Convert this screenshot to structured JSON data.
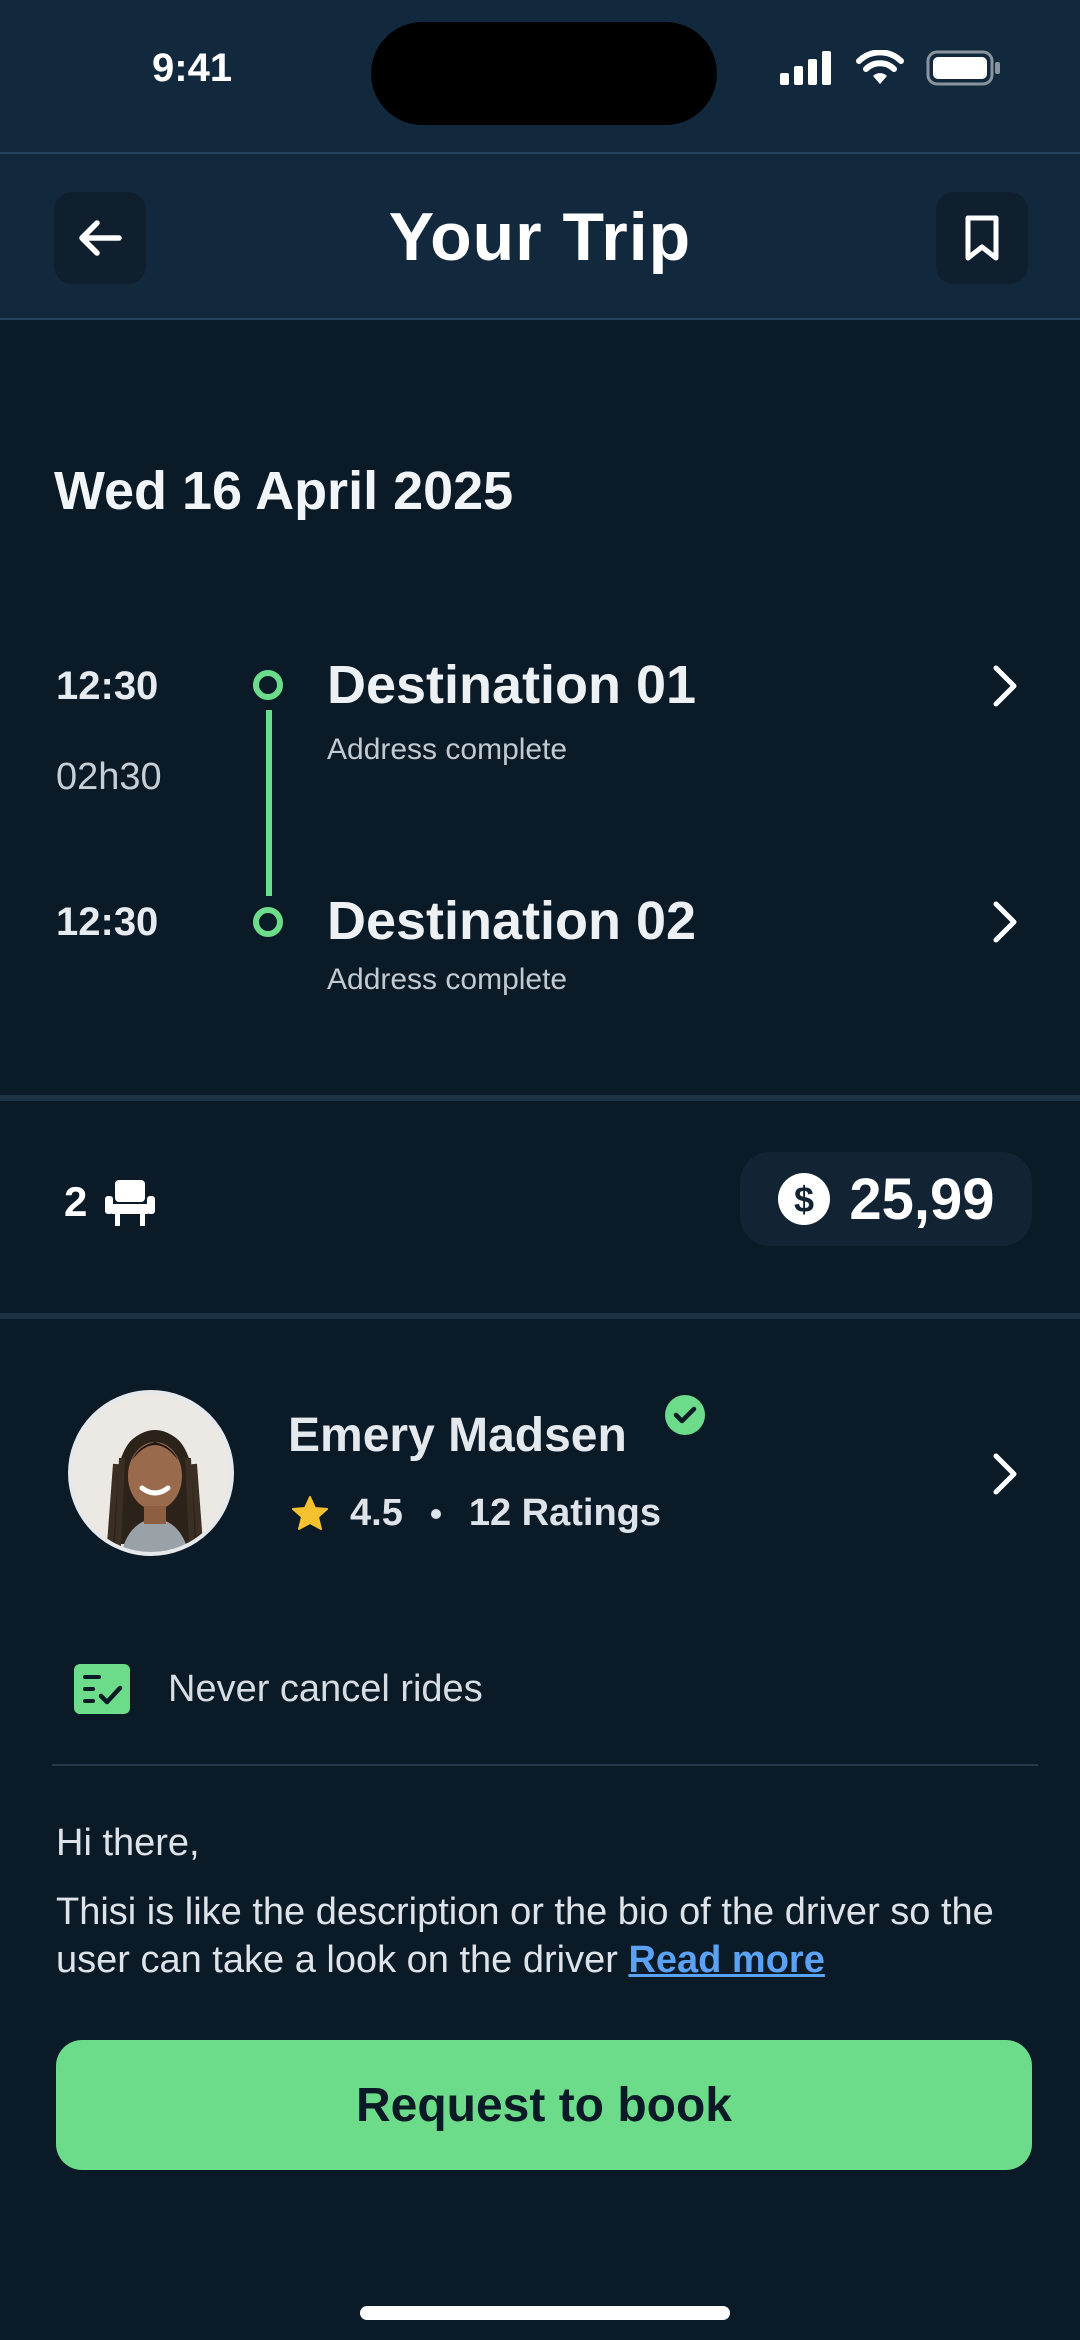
{
  "status_bar": {
    "time": "9:41"
  },
  "header": {
    "title": "Your Trip"
  },
  "trip": {
    "date": "Wed 16 April 2025",
    "duration": "02h30",
    "stops": [
      {
        "time": "12:30",
        "title": "Destination 01",
        "subtitle": "Address complete"
      },
      {
        "time": "12:30",
        "title": "Destination 02",
        "subtitle": "Address complete"
      }
    ],
    "seats": "2",
    "price": "25,99"
  },
  "driver": {
    "name": "Emery Madsen",
    "rating": "4.5",
    "ratings_count": "12 Ratings",
    "badge": "Never cancel rides",
    "greeting": "Hi there,",
    "bio": "Thisi is like the description or the bio of the driver so the user can take a look on the driver ",
    "read_more": "Read more"
  },
  "cta": {
    "label": "Request to book"
  },
  "colors": {
    "accent": "#6ddc8a",
    "background": "#0b1a27",
    "header": "#12283d",
    "link": "#5aa2f5",
    "star": "#f5c12e"
  }
}
